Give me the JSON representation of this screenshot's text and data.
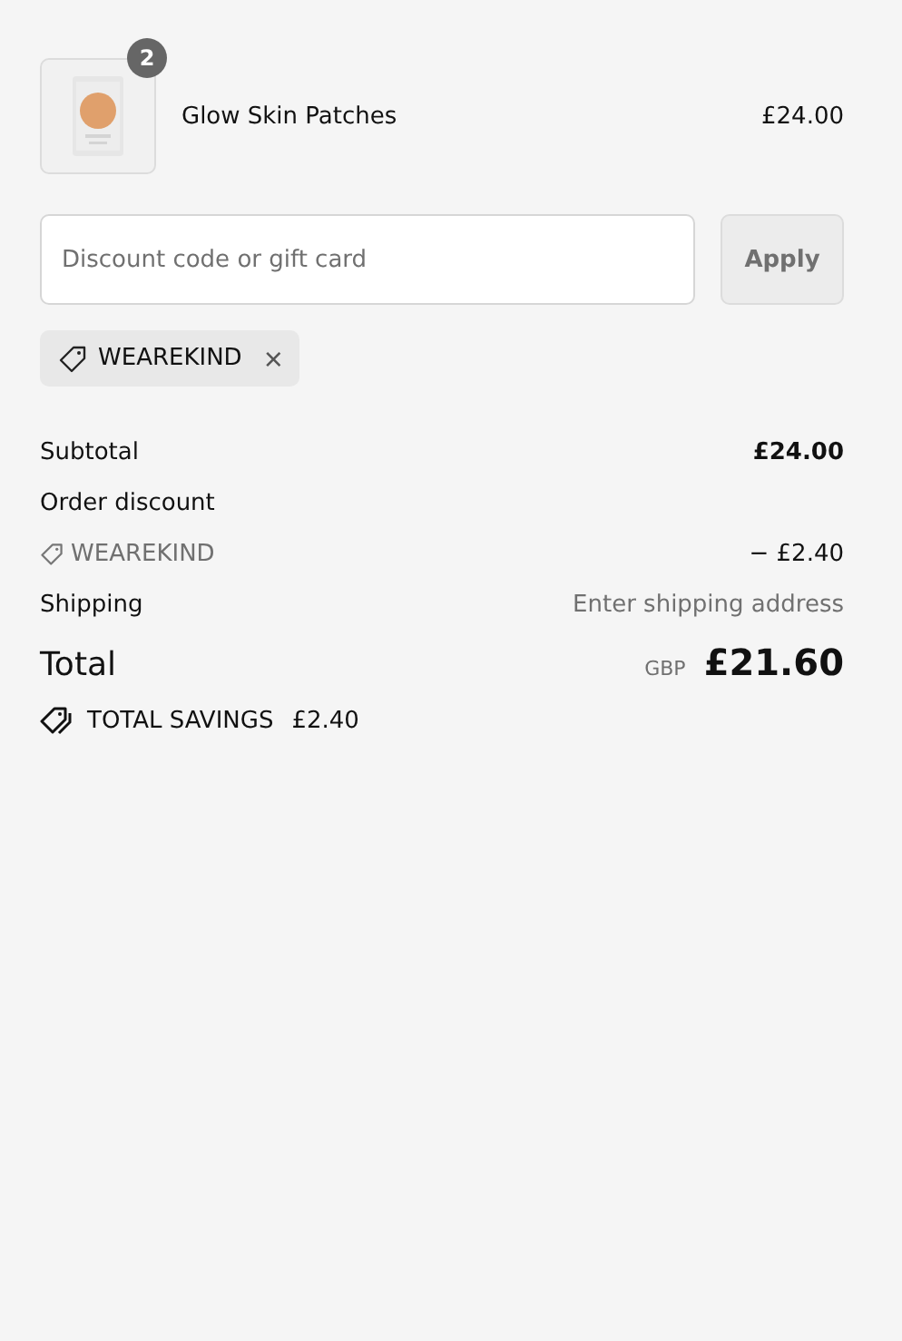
{
  "line_items": [
    {
      "quantity": "2",
      "name": "Glow Skin Patches",
      "price": "£24.00"
    }
  ],
  "discount": {
    "placeholder": "Discount code or gift card",
    "button": "Apply"
  },
  "applied_codes": [
    {
      "code": "WEAREKIND",
      "remove": "×"
    }
  ],
  "summary": [
    {
      "kind": "line",
      "label": "Subtotal",
      "value": "£24.00"
    },
    {
      "kind": "heading",
      "label": "Order discount"
    },
    {
      "kind": "code",
      "label": "WEAREKIND",
      "value": "− £2.40"
    },
    {
      "kind": "note",
      "label": "Shipping",
      "value": "Enter shipping address"
    }
  ],
  "total": {
    "label": "Total",
    "currency": "GBP",
    "amount": "£21.60"
  },
  "savings": {
    "label": "TOTAL SAVINGS",
    "amount": "£2.40"
  }
}
